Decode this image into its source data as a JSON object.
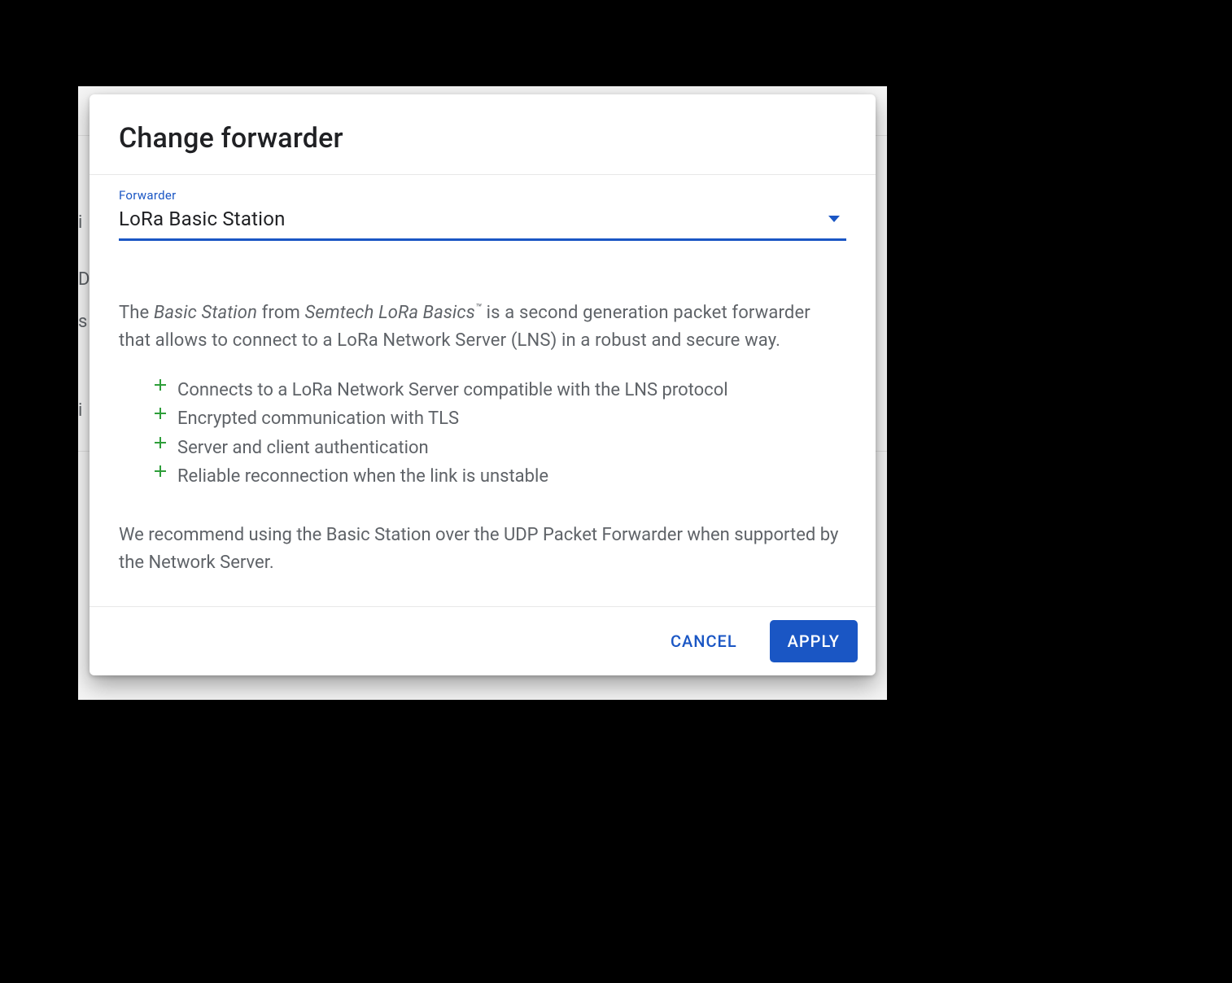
{
  "dialog": {
    "title": "Change forwarder",
    "field": {
      "label": "Forwarder",
      "value": "LoRa Basic Station"
    },
    "description": {
      "pre": "The ",
      "em1": "Basic Station",
      "mid1": " from ",
      "em2": "Semtech LoRa Basics",
      "tm": "™",
      "post": " is a second generation packet forwarder that allows to connect to a LoRa Network Server (LNS) in a robust and secure way."
    },
    "bullets": [
      "Connects to a LoRa Network Server compatible with the LNS protocol",
      "Encrypted communication with TLS",
      "Server and client authentication",
      "Reliable reconnection when the link is unstable"
    ],
    "recommendation": "We recommend using the Basic Station over the UDP Packet Forwarder when supported by the Network Server.",
    "actions": {
      "cancel": "Cancel",
      "apply": "Apply"
    }
  },
  "backdrop": {
    "l1": "i",
    "l2": "D",
    "l3": "s",
    "l4": "i"
  }
}
